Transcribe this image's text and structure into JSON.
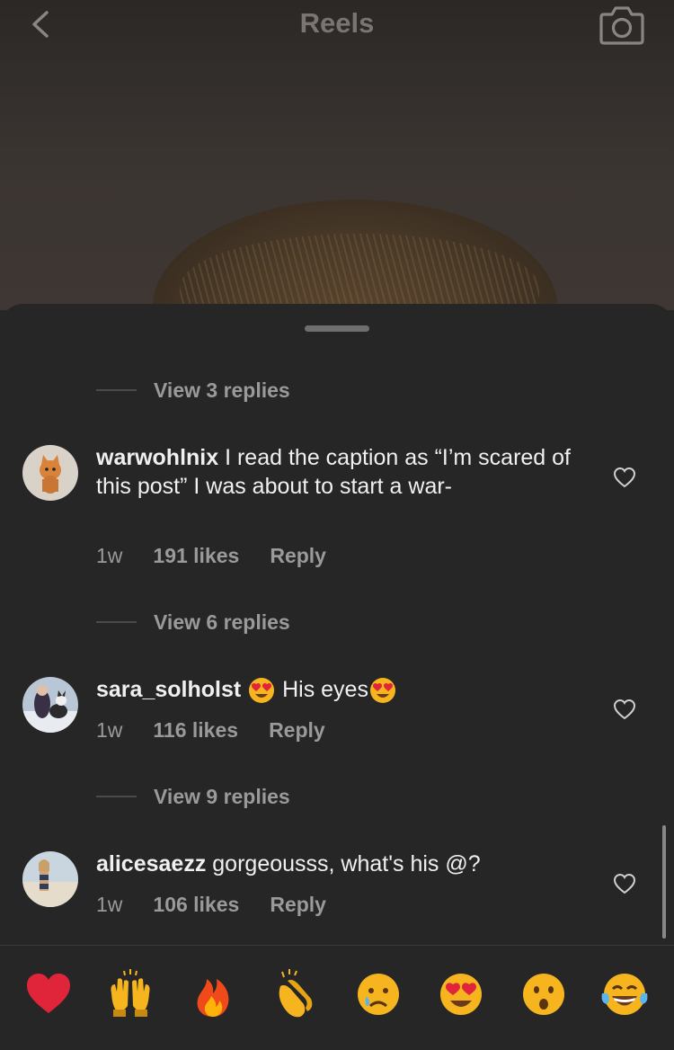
{
  "header": {
    "title": "Reels"
  },
  "replies": [
    {
      "label": "View 3 replies"
    },
    {
      "label": "View 6 replies"
    },
    {
      "label": "View 9 replies"
    }
  ],
  "comments": [
    {
      "username": "warwohlnix",
      "text": "I read the caption as “I’m scared of this post” I was about to start a war-",
      "time": "1w",
      "likes": "191 likes",
      "reply": "Reply"
    },
    {
      "username": "sara_solholst",
      "text_after_emoji": "His eyes",
      "time": "1w",
      "likes": "116 likes",
      "reply": "Reply"
    },
    {
      "username": "alicesaezz",
      "text": "gorgeousss, what's his @?",
      "time": "1w",
      "likes": "106 likes",
      "reply": "Reply"
    }
  ],
  "reactions": [
    "red-heart",
    "raising-hands",
    "fire",
    "clapping-hands",
    "crying-face",
    "heart-eyes",
    "surprised-face",
    "tears-of-joy"
  ],
  "colors": {
    "background": "#262626",
    "text": "#f0f0f0",
    "muted": "#9a9a9a",
    "heart_red": "#e0243a"
  }
}
